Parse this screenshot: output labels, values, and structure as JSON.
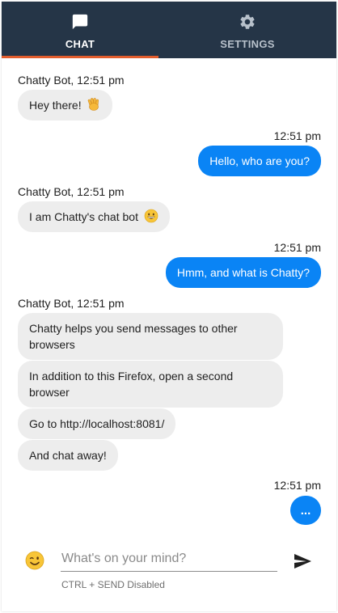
{
  "tabs": [
    {
      "label": "CHAT",
      "icon": "chat-bubble-icon",
      "active": true
    },
    {
      "label": "SETTINGS",
      "icon": "gear-icon",
      "active": false
    }
  ],
  "colors": {
    "header": "#253547",
    "active_indicator": "#e35d2d",
    "outgoing_bubble": "#0a84f5",
    "incoming_bubble": "#ededed"
  },
  "messages": [
    {
      "meta": "Chatty Bot, 12:51 pm",
      "bubbles": [
        "Hey there!"
      ],
      "emoji": "waving-hand-icon"
    },
    {
      "meta": "12:51 pm",
      "bubbles": [
        "Hello, who are you?"
      ]
    },
    {
      "meta": "Chatty Bot, 12:51 pm",
      "bubbles": [
        "I am Chatty's chat bot"
      ],
      "emoji": "grinning-face-icon"
    },
    {
      "meta": "12:51 pm",
      "bubbles": [
        "Hmm, and what is Chatty?"
      ]
    },
    {
      "meta": "Chatty Bot, 12:51 pm",
      "bubbles": [
        "Chatty helps you send messages to other browsers",
        "In addition to this Firefox, open a second browser",
        "Go to http://localhost:8081/",
        "And chat away!"
      ]
    },
    {
      "meta": "12:51 pm",
      "bubbles": [
        "..."
      ]
    }
  ],
  "composer": {
    "placeholder": "What's on your mind?",
    "value": "",
    "hint": "CTRL + SEND Disabled",
    "emoji_icon": "winking-face-icon",
    "send_icon": "send-icon"
  }
}
